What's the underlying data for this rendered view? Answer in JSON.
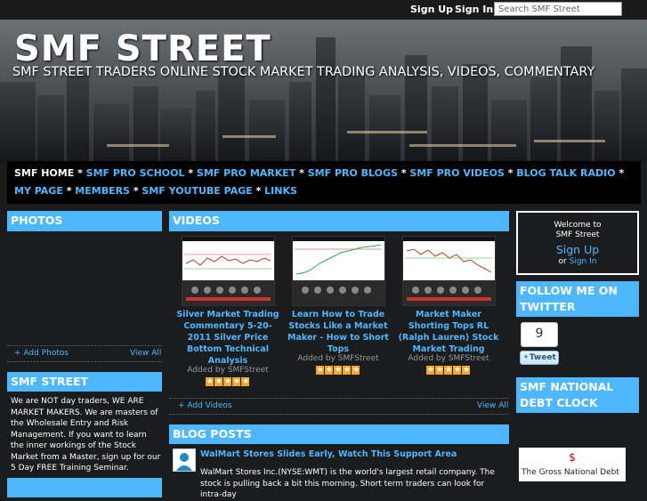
{
  "topbar": {
    "signup": "Sign Up",
    "signin": "Sign In",
    "search_placeholder": "Search SMF Street"
  },
  "banner": {
    "title": "SMF STREET",
    "subtitle": "SMF STREET TRADERS ONLINE STOCK MARKET TRADING ANALYSIS, VIDEOS, COMMENTARY"
  },
  "nav": {
    "row1": [
      "SMF HOME",
      "SMF PRO SCHOOL",
      "SMF PRO MARKET",
      "SMF PRO BLOGS",
      "SMF PRO VIDEOS",
      "BLOG TALK RADIO"
    ],
    "row2": [
      "MY PAGE",
      "MEMBERS",
      "SMF YOUTUBE PAGE",
      "LINKS"
    ],
    "separator": " * "
  },
  "photos": {
    "header": "PHOTOS",
    "add": "+ Add Photos",
    "view_all": "View All"
  },
  "smf_street": {
    "header": "SMF STREET",
    "text": "We are NOT day traders, WE ARE MARKET MAKERS. We are masters of the Wholesale Entry and Risk Management. If you want to learn the inner workings of the Stock Market from a Master, sign up for our 5 Day FREE Training Seminar."
  },
  "videos": {
    "header": "VIDEOS",
    "items": [
      {
        "title": "Silver Market Trading Commentary 5-20-2011 Silver Price Bottom Technical Analysis",
        "by": "Added by SMFStreet"
      },
      {
        "title": "Learn How to Trade Stocks Like a Market Maker - How to Short Tops",
        "by": "Added by SMFStreet"
      },
      {
        "title": "Market Maker Shorting Tops RL (Ralph Lauren) Stock Market Trading",
        "by": "Added by SMFStreet"
      }
    ],
    "add": "+ Add Videos",
    "view_all": "View All"
  },
  "blog": {
    "header": "BLOG POSTS",
    "post_title": "WalMart Stores Slides Early, Watch This Support Area",
    "post_body": "WalMart Stores Inc.(NYSE:WMT) is the world's largest retail company. The stock is pulling back a bit this morning. Short term traders can look for intra-day"
  },
  "welcome": {
    "line1": "Welcome to",
    "line2": "SMF Street",
    "signup": "Sign Up",
    "or": "or",
    "signin": "Sign In"
  },
  "twitter": {
    "header": "FOLLOW ME ON TWITTER",
    "count": "9",
    "button": "Tweet"
  },
  "debt": {
    "header": "SMF NATIONAL DEBT CLOCK",
    "dollar": "$",
    "label": "The Gross National Debt"
  },
  "colors": {
    "accent": "#4db8ff",
    "background": "#1b1c1e",
    "star": "#f5a623"
  }
}
